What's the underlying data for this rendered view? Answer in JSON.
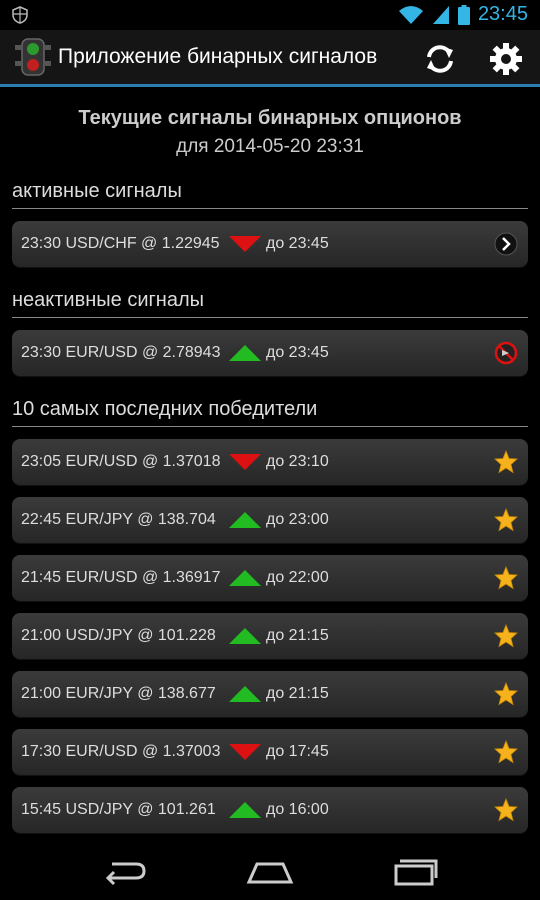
{
  "status_bar": {
    "time": "23:45"
  },
  "app": {
    "title": "Приложение бинарных сигналов"
  },
  "header": {
    "title": "Текущие сигналы бинарных опционов",
    "subtitle": "для 2014-05-20 23:31"
  },
  "sections": {
    "active": "активные сигналы",
    "inactive": "неактивные сигналы",
    "winners": "10 самых последних победители"
  },
  "active_signals": [
    {
      "text": "23:30 USD/CHF @ 1.22945",
      "direction": "down",
      "until": "до 23:45",
      "icon": "chevron-right-icon"
    }
  ],
  "inactive_signals": [
    {
      "text": "23:30 EUR/USD @ 2.78943",
      "direction": "up",
      "until": "до 23:45",
      "icon": "no-entry-icon"
    }
  ],
  "winners": [
    {
      "text": "23:05 EUR/USD @ 1.37018",
      "direction": "down",
      "until": "до 23:10",
      "icon": "star-icon"
    },
    {
      "text": "22:45 EUR/JPY @ 138.704",
      "direction": "up",
      "until": "до 23:00",
      "icon": "star-icon"
    },
    {
      "text": "21:45 EUR/USD @ 1.36917",
      "direction": "up",
      "until": "до 22:00",
      "icon": "star-icon"
    },
    {
      "text": "21:00 USD/JPY @ 101.228",
      "direction": "up",
      "until": "до 21:15",
      "icon": "star-icon"
    },
    {
      "text": "21:00 EUR/JPY @ 138.677",
      "direction": "up",
      "until": "до 21:15",
      "icon": "star-icon"
    },
    {
      "text": "17:30 EUR/USD @ 1.37003",
      "direction": "down",
      "until": "до 17:45",
      "icon": "star-icon"
    },
    {
      "text": "15:45 USD/JPY @ 101.261",
      "direction": "up",
      "until": "до 16:00",
      "icon": "star-icon"
    }
  ],
  "colors": {
    "accent": "#33b5e5",
    "up": "#22bb22",
    "down": "#dd1111",
    "star": "#f5b21c"
  }
}
